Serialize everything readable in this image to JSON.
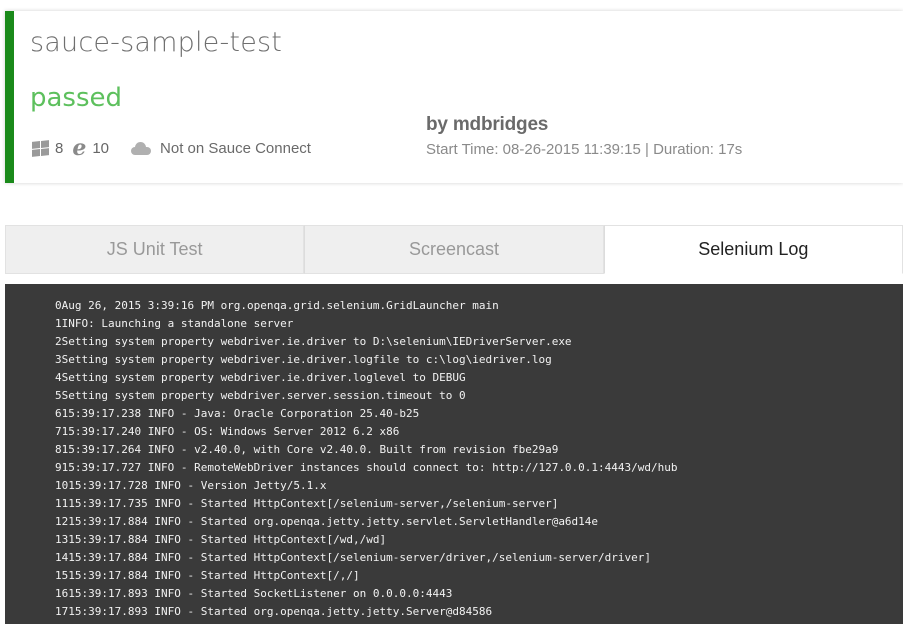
{
  "job": {
    "name": "sauce-sample-test",
    "status": "passed",
    "os_version": "8",
    "browser_version": "10",
    "tunnel": "Not on Sauce Connect",
    "owner": "by mdbridges",
    "meta": "Start Time: 08-26-2015 11:39:15 | Duration: 17s",
    "icons": [
      "windows-icon",
      "ie-icon",
      "cloud-icon"
    ],
    "colors": {
      "status_bar": "#1a8a1a",
      "status_text": "#5dc05d",
      "log_bg": "#3a3a3a"
    }
  },
  "tabs": [
    {
      "label": "JS Unit Test",
      "active": false
    },
    {
      "label": "Screencast",
      "active": false
    },
    {
      "label": "Selenium Log",
      "active": true
    }
  ],
  "log": [
    "0Aug 26, 2015 3:39:16 PM org.openqa.grid.selenium.GridLauncher main",
    "1INFO: Launching a standalone server",
    "2Setting system property webdriver.ie.driver to D:\\selenium\\IEDriverServer.exe",
    "3Setting system property webdriver.ie.driver.logfile to c:\\log\\iedriver.log",
    "4Setting system property webdriver.ie.driver.loglevel to DEBUG",
    "5Setting system property webdriver.server.session.timeout to 0",
    "615:39:17.238 INFO - Java: Oracle Corporation 25.40-b25",
    "715:39:17.240 INFO - OS: Windows Server 2012 6.2 x86",
    "815:39:17.264 INFO - v2.40.0, with Core v2.40.0. Built from revision fbe29a9",
    "915:39:17.727 INFO - RemoteWebDriver instances should connect to: http://127.0.0.1:4443/wd/hub",
    "1015:39:17.728 INFO - Version Jetty/5.1.x",
    "1115:39:17.735 INFO - Started HttpContext[/selenium-server,/selenium-server]",
    "1215:39:17.884 INFO - Started org.openqa.jetty.jetty.servlet.ServletHandler@a6d14e",
    "1315:39:17.884 INFO - Started HttpContext[/wd,/wd]",
    "1415:39:17.884 INFO - Started HttpContext[/selenium-server/driver,/selenium-server/driver]",
    "1515:39:17.884 INFO - Started HttpContext[/,/]",
    "1615:39:17.893 INFO - Started SocketListener on 0.0.0.0:4443",
    "1715:39:17.893 INFO - Started org.openqa.jetty.jetty.Server@d84586"
  ]
}
